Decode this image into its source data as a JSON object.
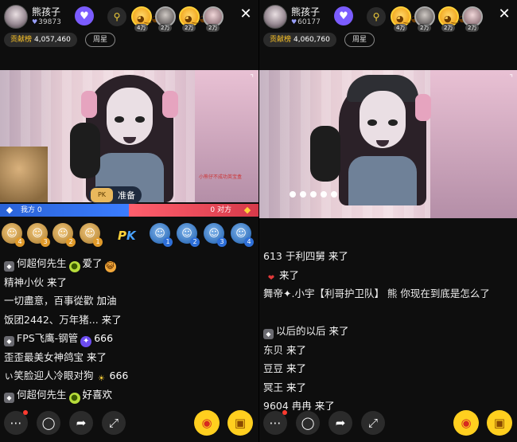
{
  "left": {
    "host": {
      "name": "熊孩子",
      "fans": "39873"
    },
    "contrib_label": "贡献榜",
    "contrib_value": "4,057,460",
    "week_star": "周星",
    "viewers": [
      {
        "tag": "4万"
      },
      {
        "tag": "2万"
      },
      {
        "tag": "2万"
      },
      {
        "tag": "2万"
      }
    ],
    "pk": {
      "ready": "准备",
      "us_label": "我方",
      "us_score": "0",
      "them_score": "0",
      "them_label": "对方",
      "logo_p": "P",
      "logo_k": "K",
      "our_seats": [
        "4",
        "3",
        "2",
        "1"
      ],
      "their_seats": [
        "1",
        "2",
        "3",
        "4"
      ]
    },
    "video_caption": "小熊仔不成功英宝盒",
    "chat": [
      {
        "user": "何超何先生",
        "text": "爱了",
        "badge": "",
        "icons": [
          "fruit",
          "cat"
        ]
      },
      {
        "user": "精神小伙",
        "text": "来了",
        "badge": "",
        "icons": []
      },
      {
        "user": "一切盡意，百事從歡",
        "text": "加油",
        "badge": "",
        "icons": []
      },
      {
        "user": "饭团2442、万年猪...",
        "text": "来了",
        "badge": "",
        "icons": []
      },
      {
        "user": "FPS飞鹰-钢管",
        "text": "666",
        "badge": "",
        "icons": [
          "orb"
        ]
      },
      {
        "user": "歪歪最美女神鸽宝",
        "text": "来了",
        "badge": "",
        "icons": []
      },
      {
        "user": "ぃ笑脸迎人冷眼对狗",
        "text": "666",
        "badge": "",
        "icons": [
          "sun"
        ]
      },
      {
        "user": "何超何先生",
        "text": "好喜欢",
        "badge": "",
        "icons": [
          "fruit"
        ]
      }
    ]
  },
  "right": {
    "host": {
      "name": "熊孩子",
      "fans": "60177"
    },
    "contrib_label": "贡献榜",
    "contrib_value": "4,060,760",
    "week_star": "周星",
    "viewers": [
      {
        "tag": "4万"
      },
      {
        "tag": "2万"
      },
      {
        "tag": "2万"
      },
      {
        "tag": "2万"
      }
    ],
    "chat": [
      {
        "user": "613 于利四舅",
        "text": "来了"
      },
      {
        "user": "",
        "text": "来了"
      },
      {
        "user": "舞帝✦.小宇【利哥护卫队】 熊 你现在到底是怎么了",
        "text": ""
      },
      {
        "user": "以后的以后",
        "text": "来了"
      },
      {
        "user": "东贝",
        "text": "来了"
      },
      {
        "user": "豆豆",
        "text": "来了"
      },
      {
        "user": "冥王",
        "text": "来了"
      },
      {
        "user": "9604 冉冉",
        "text": "来了"
      }
    ]
  },
  "icons": {
    "follow": "follow-icon",
    "close": "close-icon",
    "more": "more-icon",
    "comment": "comment-icon",
    "share": "share-icon",
    "fullscreen": "fullscreen-icon",
    "lucky_bag": "lucky-bag-icon",
    "gift": "gift-icon"
  },
  "colors": {
    "accent": "#ffcf1f",
    "follow": "#7b5cff",
    "us": "#3b7dff",
    "them": "#ff5f6d"
  }
}
